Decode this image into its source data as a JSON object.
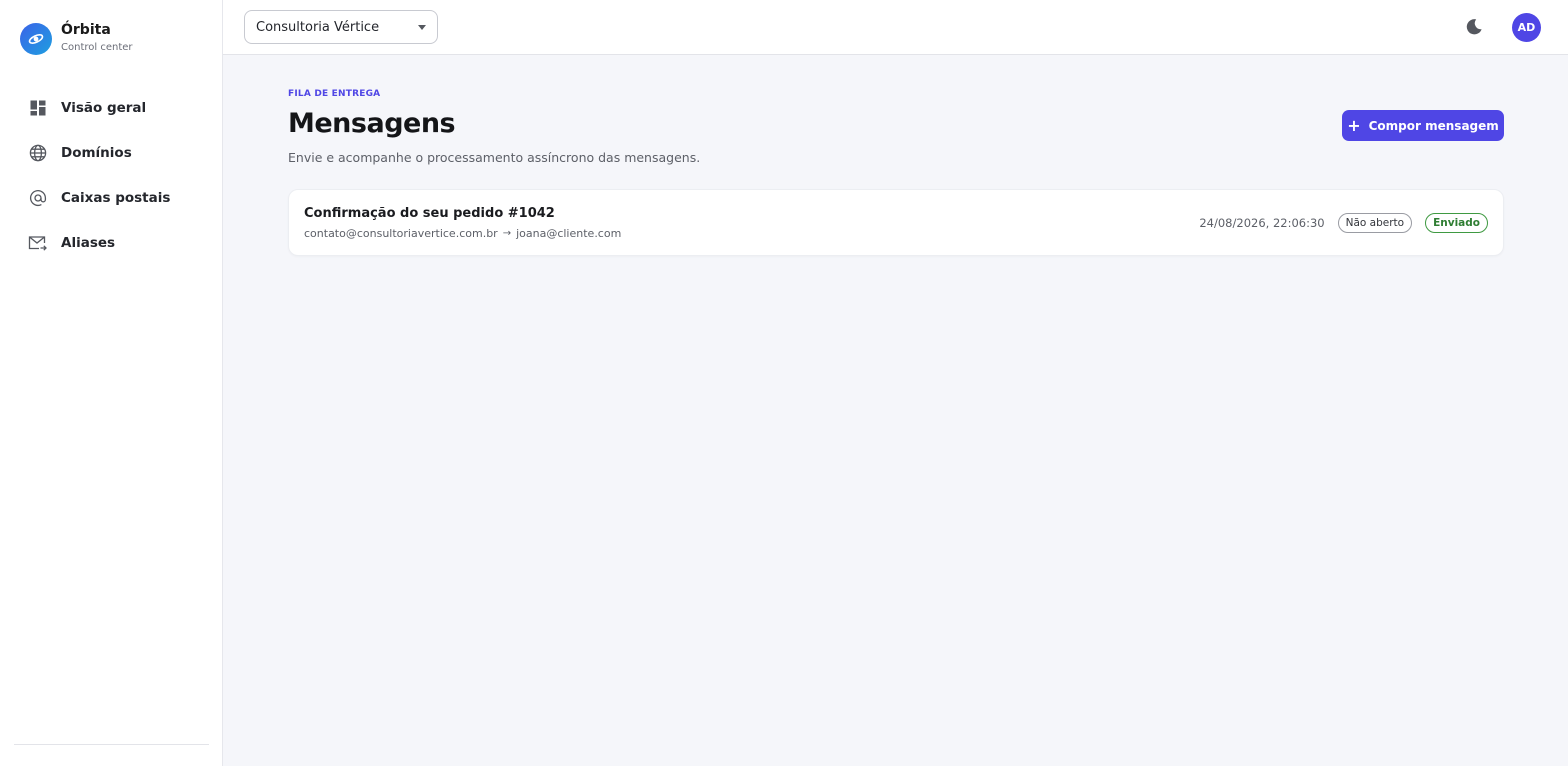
{
  "brand": {
    "name": "Órbita",
    "subtitle": "Control center"
  },
  "sidebar": {
    "items": [
      {
        "label": "Visão geral",
        "icon": "dashboard-icon"
      },
      {
        "label": "Domínios",
        "icon": "globe-icon"
      },
      {
        "label": "Caixas postais",
        "icon": "at-sign-icon"
      },
      {
        "label": "Aliases",
        "icon": "mail-forward-icon"
      }
    ]
  },
  "topbar": {
    "organization": "Consultoria Vértice",
    "avatar_initials": "AD"
  },
  "page": {
    "eyebrow": "FILA DE ENTREGA",
    "title": "Mensagens",
    "subtitle": "Envie e acompanhe o processamento assíncrono das mensagens.",
    "compose_label": "Compor mensagem"
  },
  "messages": [
    {
      "subject": "Confirmação do seu pedido #1042",
      "from": "contato@consultoriavertice.com.br",
      "to": "joana@cliente.com",
      "timestamp": "24/08/2026, 22:06:30",
      "open_status": "Não aberto",
      "delivery_status": "Enviado"
    }
  ],
  "colors": {
    "accent": "#4f46e5",
    "success": "#2e7d32",
    "background": "#f5f6fa"
  }
}
